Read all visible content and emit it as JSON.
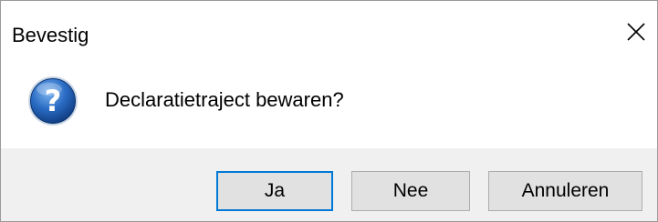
{
  "dialog": {
    "title": "Bevestig",
    "message": "Declaratietraject bewaren?",
    "icon": "question-icon",
    "close_icon": "close-icon"
  },
  "buttons": {
    "yes_label": "Ja",
    "no_label": "Nee",
    "cancel_label": "Annuleren"
  },
  "colors": {
    "footer_bg": "#f0f0f0",
    "button_bg": "#e1e1e1",
    "default_button_border": "#0078d7",
    "icon_blue": "#1e5fb4"
  }
}
